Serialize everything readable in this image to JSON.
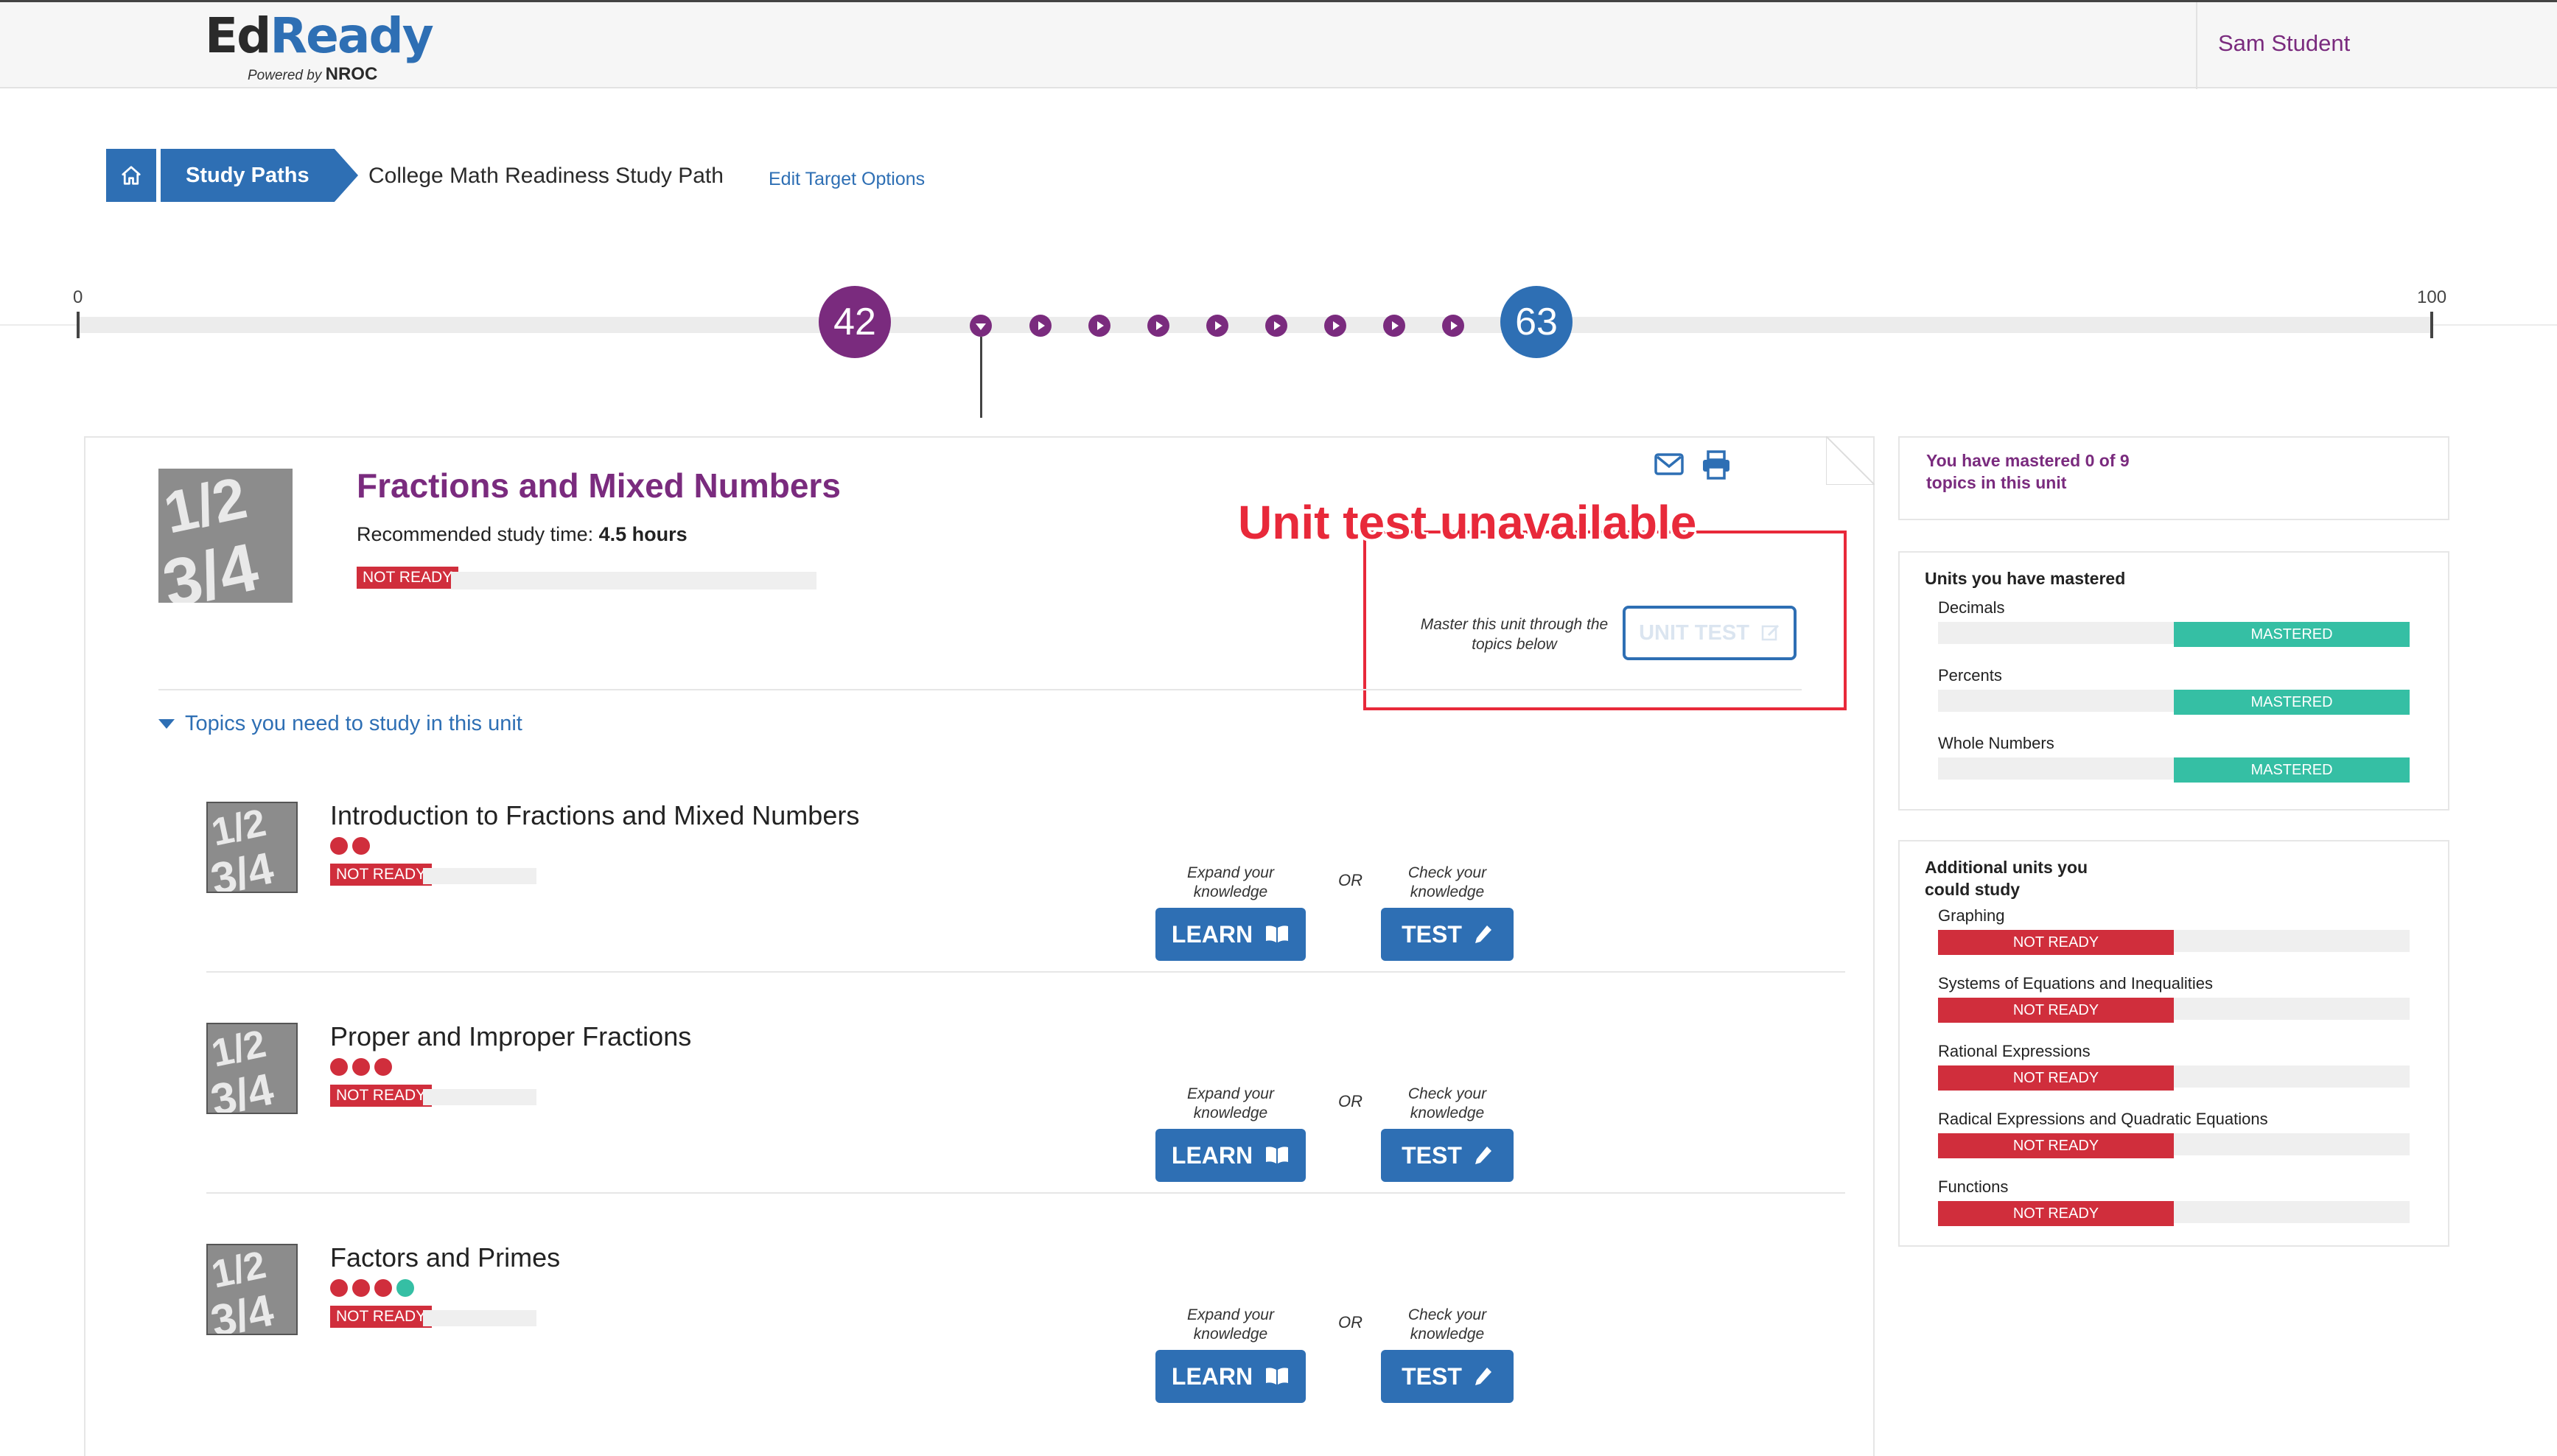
{
  "header": {
    "logo_ed": "Ed",
    "logo_ready": "Ready",
    "logo_powered": "Powered by",
    "logo_nroc": "NROC",
    "user_name": "Sam Student"
  },
  "breadcrumb": {
    "home_icon": "home-icon",
    "study_paths": "Study Paths",
    "current": "College Math Readiness Study Path",
    "edit_link": "Edit Target Options"
  },
  "score_track": {
    "min_label": "0",
    "max_label": "100",
    "current_score": "42",
    "target_score": "63",
    "step_count": 9
  },
  "unit": {
    "title": "Fractions and Mixed Numbers",
    "time_label": "Recommended study time: ",
    "time_value": "4.5 hours",
    "status": "NOT READY",
    "progress": 0,
    "master_note": "Master this unit through the topics below",
    "unit_test_label": "UNIT TEST",
    "annotation": "Unit test unavailable",
    "topics_toggle": "Topics you need to study in this unit"
  },
  "topics": [
    {
      "title": "Introduction to Fractions and Mixed Numbers",
      "status": "NOT READY",
      "dots": [
        "red",
        "red"
      ],
      "learn_hint": "Expand your knowledge",
      "or": "OR",
      "test_hint": "Check your knowledge",
      "learn": "LEARN",
      "test": "TEST"
    },
    {
      "title": "Proper and Improper Fractions",
      "status": "NOT READY",
      "dots": [
        "red",
        "red",
        "red"
      ],
      "learn_hint": "Expand your knowledge",
      "or": "OR",
      "test_hint": "Check your knowledge",
      "learn": "LEARN",
      "test": "TEST"
    },
    {
      "title": "Factors and Primes",
      "status": "NOT READY",
      "dots": [
        "red",
        "red",
        "red",
        "teal"
      ],
      "learn_hint": "Expand your knowledge",
      "or": "OR",
      "test_hint": "Check your knowledge",
      "learn": "LEARN",
      "test": "TEST"
    }
  ],
  "sidebar": {
    "mastered_summary": "You have mastered 0 of 9 topics in this unit",
    "mastered_units_title": "Units you have mastered",
    "mastered_units": [
      {
        "name": "Decimals",
        "status": "MASTERED"
      },
      {
        "name": "Percents",
        "status": "MASTERED"
      },
      {
        "name": "Whole Numbers",
        "status": "MASTERED"
      }
    ],
    "additional_title": "Additional units you could study",
    "additional_units": [
      {
        "name": "Graphing",
        "status": "NOT READY"
      },
      {
        "name": "Systems of Equations and Inequalities",
        "status": "NOT READY"
      },
      {
        "name": "Rational Expressions",
        "status": "NOT READY"
      },
      {
        "name": "Radical Expressions and Quadratic Equations",
        "status": "NOT READY"
      },
      {
        "name": "Functions",
        "status": "NOT READY"
      }
    ]
  },
  "colors": {
    "brand_blue": "#2e6fb4",
    "brand_purple": "#7a2b7e",
    "not_ready_red": "#d02e3c",
    "mastered_teal": "#35bfa4",
    "annotation_red": "#e8293a"
  }
}
